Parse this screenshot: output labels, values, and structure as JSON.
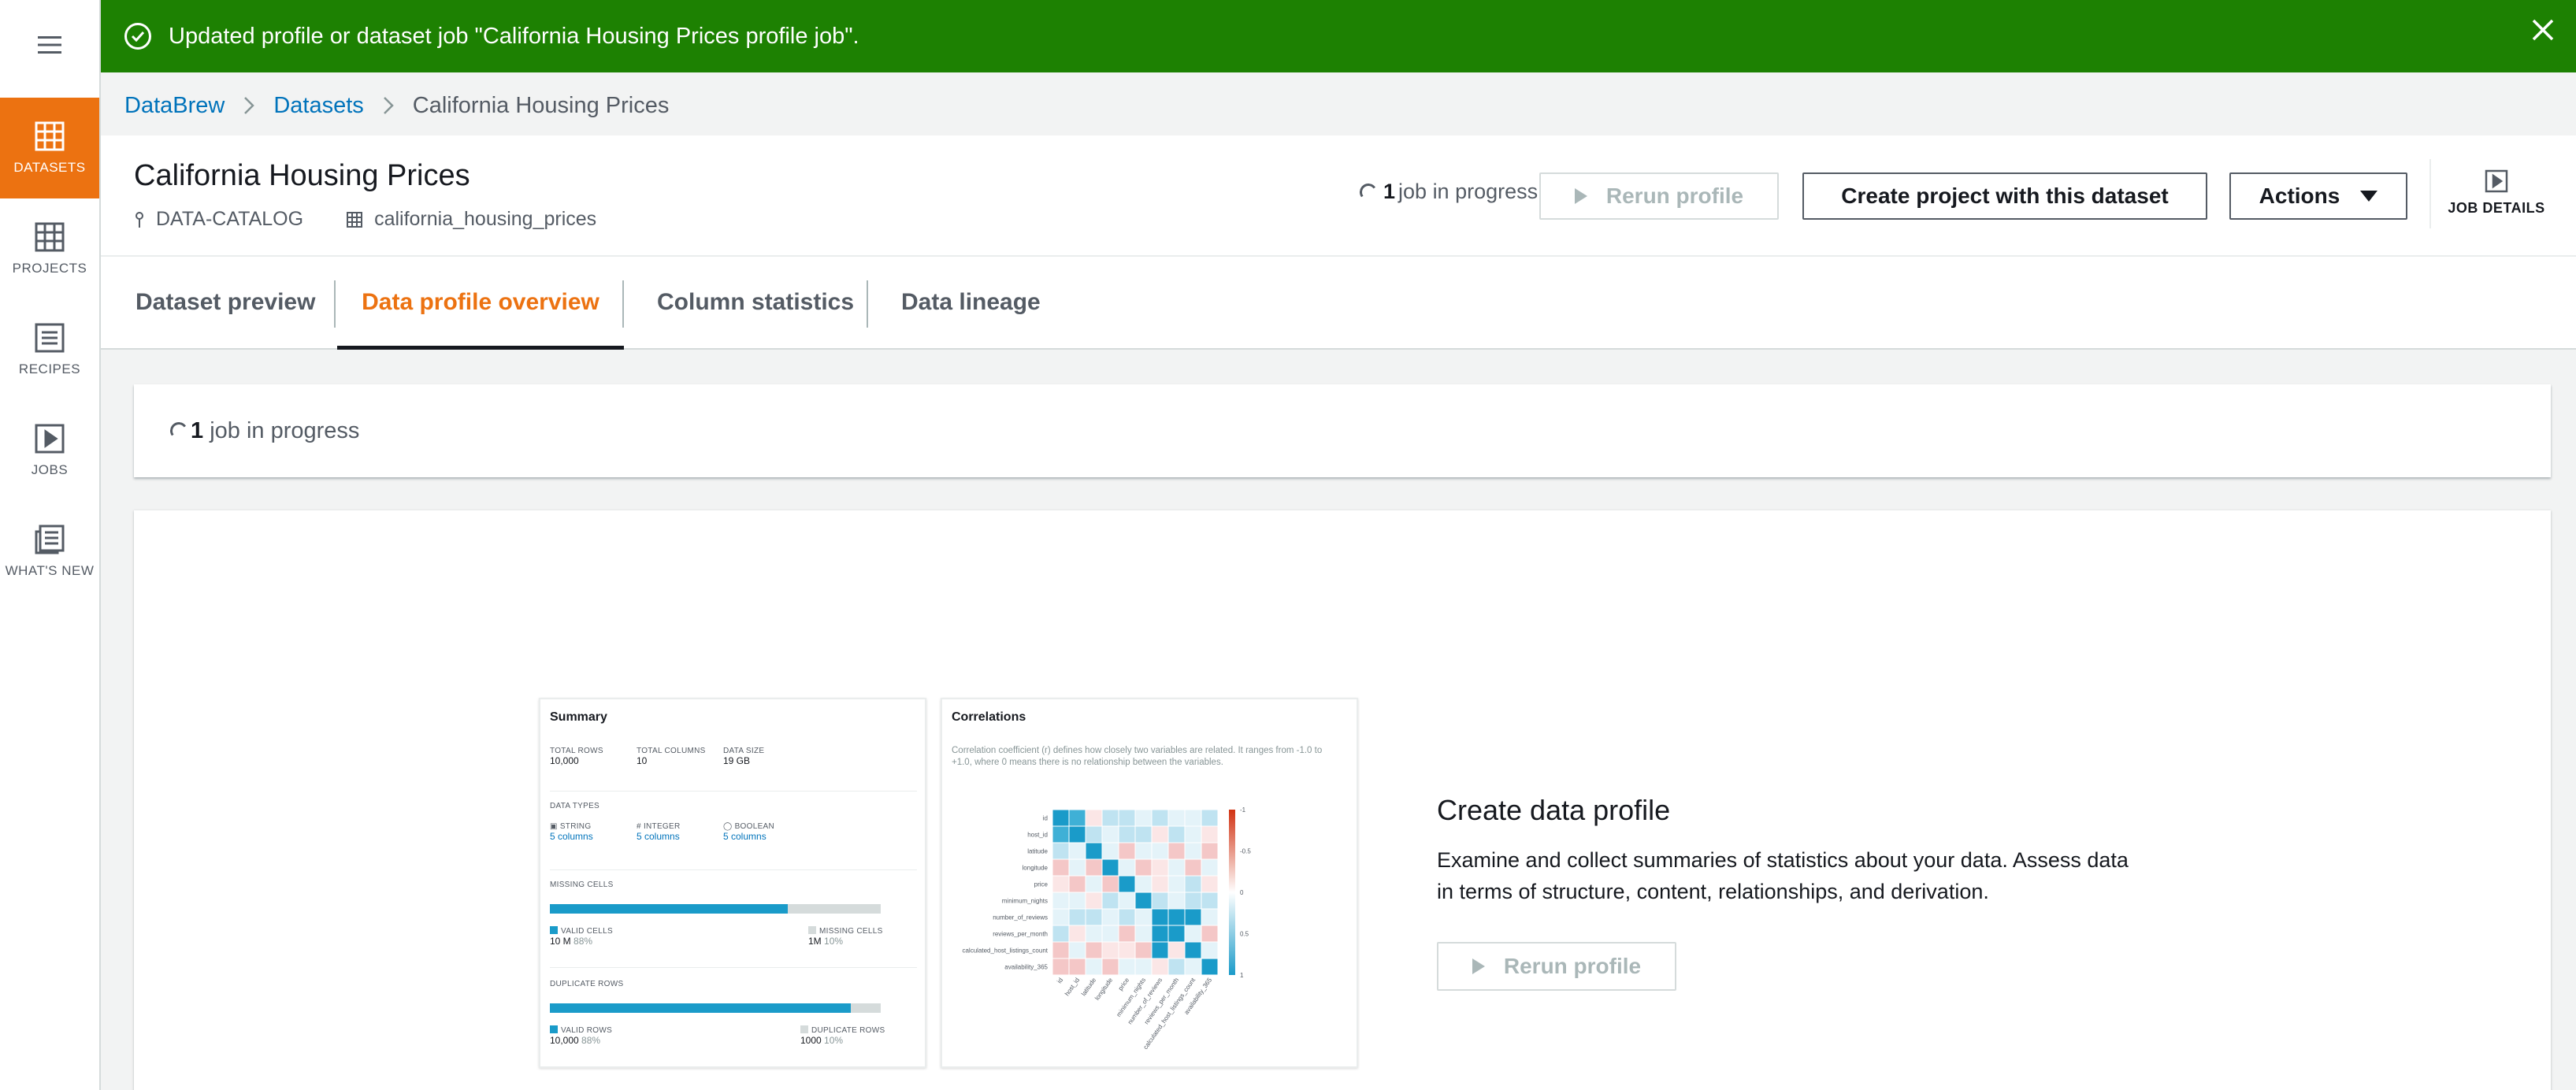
{
  "nav": {
    "items": [
      {
        "label": "DATASETS",
        "icon": "grid-icon",
        "active": true
      },
      {
        "label": "PROJECTS",
        "icon": "grid-icon"
      },
      {
        "label": "RECIPES",
        "icon": "list-icon"
      },
      {
        "label": "JOBS",
        "icon": "play-icon"
      },
      {
        "label": "WHAT'S NEW",
        "icon": "news-icon"
      }
    ]
  },
  "flash": {
    "message": "Updated profile or dataset job \"California Housing Prices profile job\".",
    "color": "#1d8102"
  },
  "breadcrumb": [
    "DataBrew",
    "Datasets",
    "California Housing Prices"
  ],
  "header": {
    "title": "California Housing Prices",
    "source": "DATA-CATALOG",
    "table": "california_housing_prices",
    "jobs_count": "1",
    "jobs_text": "job in progress",
    "rerun_label": "Rerun profile",
    "create_project_label": "Create project with this dataset",
    "actions_label": "Actions",
    "job_details_label": "JOB DETAILS"
  },
  "tabs": [
    "Dataset preview",
    "Data profile overview",
    "Column statistics",
    "Data lineage"
  ],
  "active_tab": 1,
  "job_panel": {
    "count": "1",
    "text": "job in progress"
  },
  "summary_card": {
    "title": "Summary",
    "total_rows_label": "TOTAL ROWS",
    "total_rows": "10,000",
    "total_columns_label": "TOTAL COLUMNS",
    "total_columns": "10",
    "data_size_label": "DATA SIZE",
    "data_size": "19 GB",
    "data_types_label": "DATA TYPES",
    "types": [
      {
        "name": "STRING",
        "value": "5 columns"
      },
      {
        "name": "INTEGER",
        "value": "5 columns"
      },
      {
        "name": "BOOLEAN",
        "value": "5 columns"
      }
    ],
    "missing_label": "MISSING CELLS",
    "missing_fill": 0.72,
    "valid_cells_label": "VALID CELLS",
    "valid_cells": "10 M",
    "valid_cells_pct": "88%",
    "missing_cells_label": "MISSING CELLS",
    "missing_cells": "1M",
    "missing_cells_pct": "10%",
    "duplicate_label": "DUPLICATE ROWS",
    "duplicate_fill": 0.91,
    "valid_rows_label": "VALID ROWS",
    "valid_rows": "10,000",
    "valid_rows_pct": "88%",
    "dup_rows_label": "DUPLICATE ROWS",
    "dup_rows": "1000",
    "dup_rows_pct": "10%"
  },
  "correlations_card": {
    "title": "Correlations",
    "description": "Correlation coefficient (r) defines how closely two variables are related. It ranges from -1.0 to +1.0, where 0 means there is no relationship between the variables.",
    "variables": [
      "id",
      "host_id",
      "latitude",
      "longitude",
      "price",
      "minimum_nights",
      "number_of_reviews",
      "reviews_per_month",
      "calculated_host_listings_count",
      "availability_365"
    ],
    "scale": [
      "-1",
      "-0.5",
      "0",
      "0.5",
      "1"
    ]
  },
  "create_profile": {
    "title": "Create data profile",
    "text": "Examine and collect summaries of statistics about your data. Assess data in terms of structure, content, relationships, and derivation.",
    "button": "Rerun profile"
  },
  "colors": {
    "accent": "#ec7211",
    "link": "#0073bb",
    "bar": "#1a9bc9",
    "success": "#1d8102"
  }
}
